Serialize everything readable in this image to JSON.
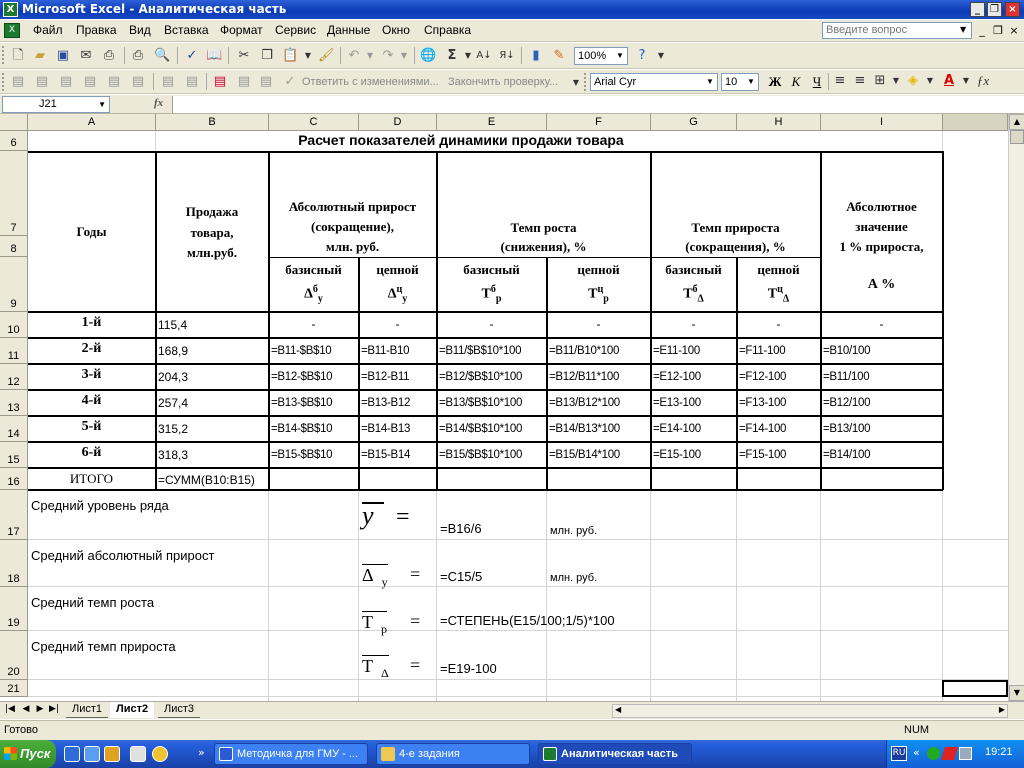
{
  "window": {
    "title": "Microsoft Excel - Аналитическая часть"
  },
  "menu": {
    "items": [
      "Файл",
      "Правка",
      "Вид",
      "Вставка",
      "Формат",
      "Сервис",
      "Данные",
      "Окно",
      "Справка"
    ],
    "help_placeholder": "Введите вопрос"
  },
  "toolbar": {
    "zoom": "100%",
    "review_reply": "Ответить с изменениями...",
    "review_end": "Закончить проверку...",
    "font_name": "Arial Cyr",
    "font_size": "10",
    "bold_label": "Ж",
    "italic_label": "К",
    "underline_label": "Ч"
  },
  "formula_bar": {
    "name_box": "J21",
    "fx_label": "fx",
    "content": ""
  },
  "columns": [
    "A",
    "B",
    "C",
    "D",
    "E",
    "F",
    "G",
    "H",
    "I"
  ],
  "rows": [
    "6",
    "7",
    "8",
    "9",
    "10",
    "11",
    "12",
    "13",
    "14",
    "15",
    "16",
    "17",
    "18",
    "19",
    "20",
    "21"
  ],
  "sheet": {
    "title": "Расчет показателей динамики продажи товара",
    "headers": {
      "years": "Годы",
      "sales": [
        "Продажа",
        "товара,",
        "млн.руб."
      ],
      "abs_growth": [
        "Абсолютный прирост",
        "(сокращение),",
        "млн. руб."
      ],
      "growth_rate": [
        "Темп роста",
        "(снижения), %"
      ],
      "increase_rate": [
        "Темп прироста",
        "(сокращения), %"
      ],
      "abs_value": [
        "Абсолютное",
        "значение",
        "1 % прироста,"
      ],
      "basic": "базисный",
      "chain": "цепной",
      "sym_abs_basic": {
        "main": "Δ",
        "sup": "б",
        "sub": "у"
      },
      "sym_abs_chain": {
        "main": "Δ",
        "sup": "ц",
        "sub": "у"
      },
      "sym_rate_basic": {
        "main": "Т",
        "sup": "б",
        "sub": "р"
      },
      "sym_rate_chain": {
        "main": "Т",
        "sup": "ц",
        "sub": "р"
      },
      "sym_inc_basic": {
        "main": "Т",
        "sup": "б",
        "sub": "Δ"
      },
      "sym_inc_chain": {
        "main": "Т",
        "sup": "ц",
        "sub": "Δ"
      },
      "sym_percent": "А %"
    },
    "data_rows": [
      {
        "year": "1-й",
        "sales": "115,4",
        "c": "-",
        "d": "-",
        "e": "-",
        "f": "-",
        "g": "-",
        "h": "-",
        "i": "-"
      },
      {
        "year": "2-й",
        "sales": "168,9",
        "c": "=B11-$B$10",
        "d": "=B11-B10",
        "e": "=B11/$B$10*100",
        "f": "=B11/B10*100",
        "g": "=E11-100",
        "h": "=F11-100",
        "i": "=B10/100"
      },
      {
        "year": "3-й",
        "sales": "204,3",
        "c": "=B12-$B$10",
        "d": "=B12-B11",
        "e": "=B12/$B$10*100",
        "f": "=B12/B11*100",
        "g": "=E12-100",
        "h": "=F12-100",
        "i": "=B11/100"
      },
      {
        "year": "4-й",
        "sales": "257,4",
        "c": "=B13-$B$10",
        "d": "=B13-B12",
        "e": "=B13/$B$10*100",
        "f": "=B13/B12*100",
        "g": "=E13-100",
        "h": "=F13-100",
        "i": "=B12/100"
      },
      {
        "year": "5-й",
        "sales": "315,2",
        "c": "=B14-$B$10",
        "d": "=B14-B13",
        "e": "=B14/$B$10*100",
        "f": "=B14/B13*100",
        "g": "=E14-100",
        "h": "=F14-100",
        "i": "=B13/100"
      },
      {
        "year": "6-й",
        "sales": "318,3",
        "c": "=B15-$B$10",
        "d": "=B15-B14",
        "e": "=B15/$B$10*100",
        "f": "=B15/B14*100",
        "g": "=E15-100",
        "h": "=F15-100",
        "i": "=B14/100"
      }
    ],
    "total": {
      "label": "ИТОГО",
      "formula": "=СУММ(B10:B15)"
    },
    "summary": [
      {
        "label": "Средний уровень ряда",
        "symbol": "y",
        "sub": "",
        "eq": "=",
        "formula": "=B16/6",
        "unit": "млн. руб."
      },
      {
        "label": "Средний абсолютный прирост",
        "symbol": "Δ",
        "sub": "у",
        "eq": "=",
        "formula": "=C15/5",
        "unit": "млн. руб."
      },
      {
        "label": "Средний темп роста",
        "symbol": "Т",
        "sub": "р",
        "eq": "=",
        "formula": "=СТЕПЕНЬ(E15/100;1/5)*100",
        "unit": ""
      },
      {
        "label": "Средний темп прироста",
        "symbol": "Т",
        "sub": "Δ",
        "eq": "=",
        "formula": "=E19-100",
        "unit": ""
      }
    ]
  },
  "tabs": [
    "Лист1",
    "Лист2",
    "Лист3"
  ],
  "status": {
    "text": "Готово",
    "num": "NUM"
  },
  "taskbar": {
    "start": "Пуск",
    "tasks": [
      "Методичка для ГМУ - ...",
      "4-е задания",
      "Аналитическая часть"
    ],
    "lang": "RU",
    "clock": "19:21"
  }
}
